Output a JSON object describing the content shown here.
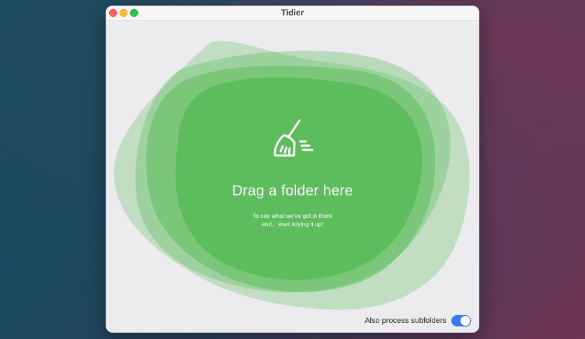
{
  "window": {
    "title": "Tidier"
  },
  "drop_zone": {
    "icon": "broom-icon",
    "title": "Drag a folder here",
    "subtitle_line1": "To see what we've got in there",
    "subtitle_line2": "and... start tidying it up!"
  },
  "options": {
    "process_subfolders_label": "Also process subfolders",
    "process_subfolders_enabled": true
  },
  "colors": {
    "accent_green": "#5cbd5c",
    "toggle_blue": "#2f7cf6",
    "close": "#fe5f57",
    "minimize": "#febc2e",
    "maximize": "#28c840"
  }
}
